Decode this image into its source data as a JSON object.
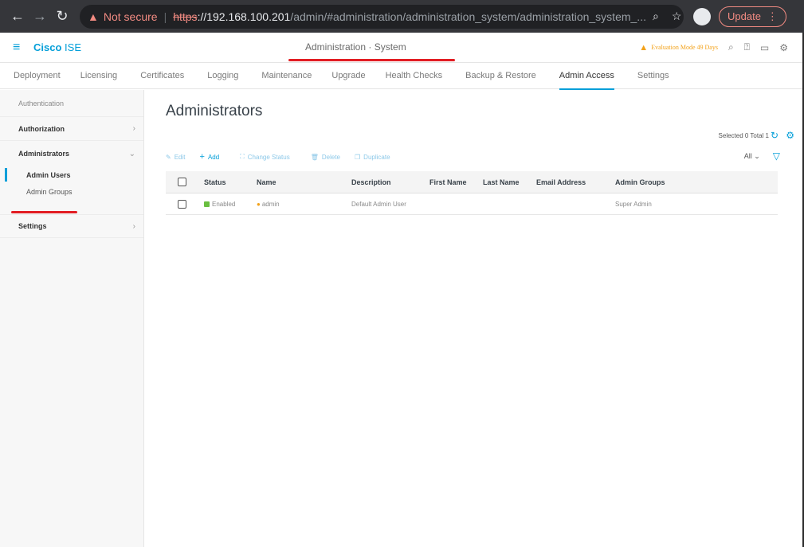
{
  "browser": {
    "back_icon": "back-arrow-icon",
    "not_secure": "Not secure",
    "url_scheme": "https",
    "url_sep": "://",
    "url_host": "192.168.100.201",
    "url_path": "/admin/#administration/administration_system/administration_system_...",
    "update_label": "Update"
  },
  "app": {
    "brand_bold": "Cisco",
    "brand_light": "ISE",
    "page_crumb": "Administration · System",
    "evaluation": "Evaluation Mode 49 Days"
  },
  "tabs": [
    "Deployment",
    "Licensing",
    "Certificates",
    "Logging",
    "Maintenance",
    "Upgrade",
    "Health Checks",
    "Backup & Restore",
    "Admin Access",
    "Settings"
  ],
  "active_tab": "Admin Access",
  "sidebar": {
    "authentication": "Authentication",
    "authorization": "Authorization",
    "administrators": "Administrators",
    "admin_users": "Admin Users",
    "admin_groups": "Admin Groups",
    "settings": "Settings"
  },
  "main": {
    "title": "Administrators",
    "selected_total": "Selected 0  Total 1",
    "toolbar": {
      "edit": "Edit",
      "add": "Add",
      "change_status": "Change Status",
      "delete": "Delete",
      "duplicate": "Duplicate"
    },
    "filter_all": "All"
  },
  "table": {
    "headers": [
      "Status",
      "Name",
      "Description",
      "First Name",
      "Last Name",
      "Email Address",
      "Admin Groups"
    ],
    "rows": [
      {
        "status": "Enabled",
        "name": "admin",
        "description": "Default Admin User",
        "first_name": "",
        "last_name": "",
        "email": "",
        "admin_groups": "Super Admin"
      }
    ]
  },
  "colors": {
    "accent": "#049fd9",
    "annotation_red": "#e21d23",
    "warning": "#f3a21a",
    "enabled_green": "#6abf40"
  }
}
